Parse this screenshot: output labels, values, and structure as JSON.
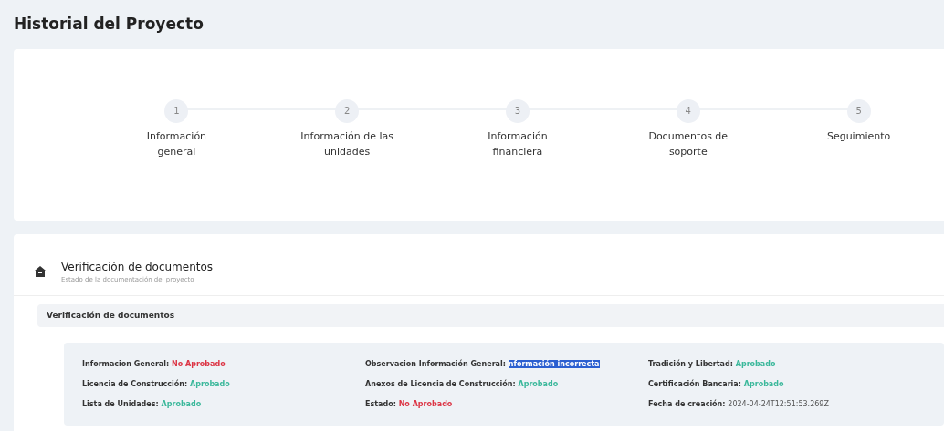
{
  "page_title": "Historial del Proyecto",
  "steps": [
    {
      "number": "1",
      "label": "Información general"
    },
    {
      "number": "2",
      "label": "Información de las unidades"
    },
    {
      "number": "3",
      "label": "Información financiera"
    },
    {
      "number": "4",
      "label": "Documentos de soporte"
    },
    {
      "number": "5",
      "label": "Seguimiento"
    }
  ],
  "section": {
    "title": "Verificación de documentos",
    "subtitle": "Estado de la documentación del proyecto"
  },
  "accordion": {
    "title": "Verificación de documentos"
  },
  "fields": [
    {
      "label": "Informacion General:",
      "value": "No Aprobado",
      "kind": "rejected"
    },
    {
      "label": "Observacion Información General:",
      "value": "nformación incorrecta",
      "kind": "selected_text"
    },
    {
      "label": "Tradición y Libertad:",
      "value": "Aprobado",
      "kind": "approved"
    },
    {
      "label": "Licencia de Construcción:",
      "value": "Aprobado",
      "kind": "approved"
    },
    {
      "label": "Anexos de Licencia de Construcción:",
      "value": "Aprobado",
      "kind": "approved"
    },
    {
      "label": "Certificación Bancaria:",
      "value": "Aprobado",
      "kind": "approved"
    },
    {
      "label": "Lista de Unidades:",
      "value": "Aprobado",
      "kind": "approved"
    },
    {
      "label": "Estado:",
      "value": "No Aprobado",
      "kind": "rejected"
    },
    {
      "label": "Fecha de creación:",
      "value": "2024-04-24T12:51:53.269Z",
      "kind": "plain"
    }
  ]
}
